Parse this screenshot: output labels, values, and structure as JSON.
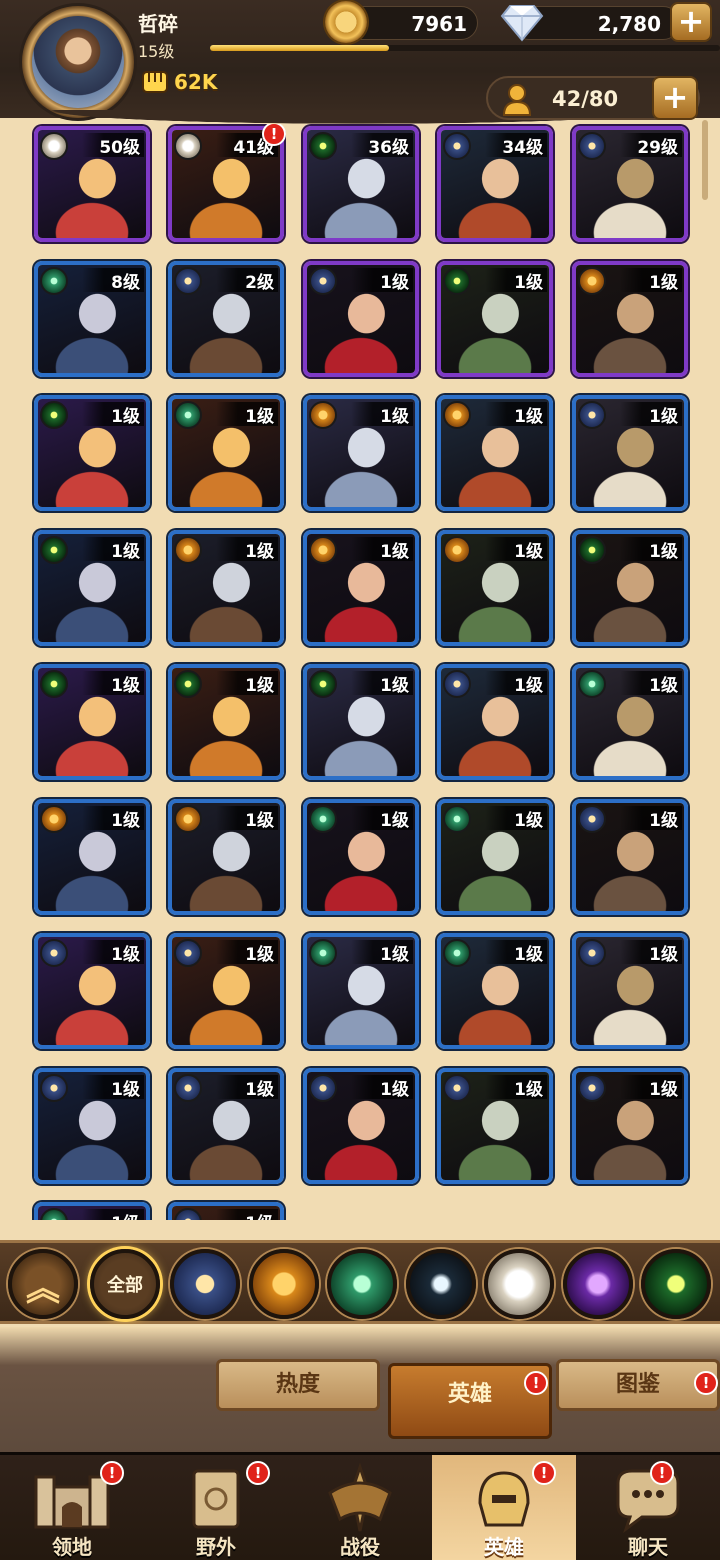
{
  "player": {
    "name": "哲碎",
    "level": "15级",
    "exp_fraction": 0.35,
    "power": "62K"
  },
  "resources": {
    "gold": "7961",
    "diamonds": "2,780"
  },
  "roster": {
    "count": "42/80"
  },
  "heroes": [
    {
      "level": "50级",
      "rarity": "epic",
      "faction": "celestial",
      "alert": ""
    },
    {
      "level": "41级",
      "rarity": "epic",
      "faction": "celestial",
      "alert": "!"
    },
    {
      "level": "36级",
      "rarity": "epic",
      "faction": "dimensional",
      "alert": ""
    },
    {
      "level": "34级",
      "rarity": "epic",
      "faction": "lightbearer",
      "alert": ""
    },
    {
      "level": "29级",
      "rarity": "epic",
      "faction": "lightbearer",
      "alert": ""
    },
    {
      "level": "8级",
      "rarity": "rare",
      "faction": "wilder",
      "alert": ""
    },
    {
      "level": "2级",
      "rarity": "rare",
      "faction": "lightbearer",
      "alert": ""
    },
    {
      "level": "1级",
      "rarity": "epic",
      "faction": "lightbearer",
      "alert": ""
    },
    {
      "level": "1级",
      "rarity": "epic",
      "faction": "dimensional",
      "alert": ""
    },
    {
      "level": "1级",
      "rarity": "epic",
      "faction": "mauler",
      "alert": ""
    },
    {
      "level": "1级",
      "rarity": "rare",
      "faction": "dimensional",
      "alert": ""
    },
    {
      "level": "1级",
      "rarity": "rare",
      "faction": "wilder",
      "alert": ""
    },
    {
      "level": "1级",
      "rarity": "rare",
      "faction": "mauler",
      "alert": ""
    },
    {
      "level": "1级",
      "rarity": "rare",
      "faction": "mauler",
      "alert": ""
    },
    {
      "level": "1级",
      "rarity": "rare",
      "faction": "lightbearer",
      "alert": ""
    },
    {
      "level": "1级",
      "rarity": "rare",
      "faction": "dimensional",
      "alert": ""
    },
    {
      "level": "1级",
      "rarity": "rare",
      "faction": "mauler",
      "alert": ""
    },
    {
      "level": "1级",
      "rarity": "rare",
      "faction": "mauler",
      "alert": ""
    },
    {
      "level": "1级",
      "rarity": "rare",
      "faction": "mauler",
      "alert": ""
    },
    {
      "level": "1级",
      "rarity": "rare",
      "faction": "dimensional",
      "alert": ""
    },
    {
      "level": "1级",
      "rarity": "rare",
      "faction": "dimensional",
      "alert": ""
    },
    {
      "level": "1级",
      "rarity": "rare",
      "faction": "dimensional",
      "alert": ""
    },
    {
      "level": "1级",
      "rarity": "rare",
      "faction": "dimensional",
      "alert": ""
    },
    {
      "level": "1级",
      "rarity": "rare",
      "faction": "lightbearer",
      "alert": ""
    },
    {
      "level": "1级",
      "rarity": "rare",
      "faction": "wilder",
      "alert": ""
    },
    {
      "level": "1级",
      "rarity": "rare",
      "faction": "mauler",
      "alert": ""
    },
    {
      "level": "1级",
      "rarity": "rare",
      "faction": "mauler",
      "alert": ""
    },
    {
      "level": "1级",
      "rarity": "rare",
      "faction": "wilder",
      "alert": ""
    },
    {
      "level": "1级",
      "rarity": "rare",
      "faction": "wilder",
      "alert": ""
    },
    {
      "level": "1级",
      "rarity": "rare",
      "faction": "lightbearer",
      "alert": ""
    },
    {
      "level": "1级",
      "rarity": "rare",
      "faction": "lightbearer",
      "alert": ""
    },
    {
      "level": "1级",
      "rarity": "rare",
      "faction": "lightbearer",
      "alert": ""
    },
    {
      "level": "1级",
      "rarity": "rare",
      "faction": "wilder",
      "alert": ""
    },
    {
      "level": "1级",
      "rarity": "rare",
      "faction": "wilder",
      "alert": ""
    },
    {
      "level": "1级",
      "rarity": "rare",
      "faction": "lightbearer",
      "alert": ""
    },
    {
      "level": "1级",
      "rarity": "rare",
      "faction": "lightbearer",
      "alert": ""
    },
    {
      "level": "1级",
      "rarity": "rare",
      "faction": "lightbearer",
      "alert": ""
    },
    {
      "level": "1级",
      "rarity": "rare",
      "faction": "lightbearer",
      "alert": ""
    },
    {
      "level": "1级",
      "rarity": "rare",
      "faction": "lightbearer",
      "alert": ""
    },
    {
      "level": "1级",
      "rarity": "rare",
      "faction": "lightbearer",
      "alert": ""
    },
    {
      "level": "1级",
      "rarity": "rare",
      "faction": "wilder",
      "alert": ""
    },
    {
      "level": "1级",
      "rarity": "rare",
      "faction": "lightbearer",
      "alert": ""
    }
  ],
  "faction_colors": {
    "lightbearer": "#3a4f86",
    "mauler": "#d9881a",
    "wilder": "#2f9a6a",
    "dimensional": "#1d6b2a",
    "celestial": "#e9e2d4",
    "hypogean": "#6b2aa6"
  },
  "filters": {
    "collapse_icon": "double-chevron-up-icon",
    "all_label": "全部",
    "factions": [
      "lightbearer",
      "mauler",
      "wilder",
      "graveborn",
      "celestial",
      "hypogean",
      "dimensional"
    ]
  },
  "sub_tabs": [
    {
      "label": "热度",
      "alert": ""
    },
    {
      "label": "英雄",
      "alert": "!"
    },
    {
      "label": "图鉴",
      "alert": "!"
    }
  ],
  "nav": [
    {
      "label": "领地",
      "icon": "castle-icon",
      "alert": "!"
    },
    {
      "label": "野外",
      "icon": "scroll-map-icon",
      "alert": "!"
    },
    {
      "label": "战役",
      "icon": "crossed-swords-icon",
      "alert": ""
    },
    {
      "label": "英雄",
      "icon": "hero-helmet-icon",
      "alert": "!"
    },
    {
      "label": "聊天",
      "icon": "chat-bubble-icon",
      "alert": "!"
    }
  ]
}
